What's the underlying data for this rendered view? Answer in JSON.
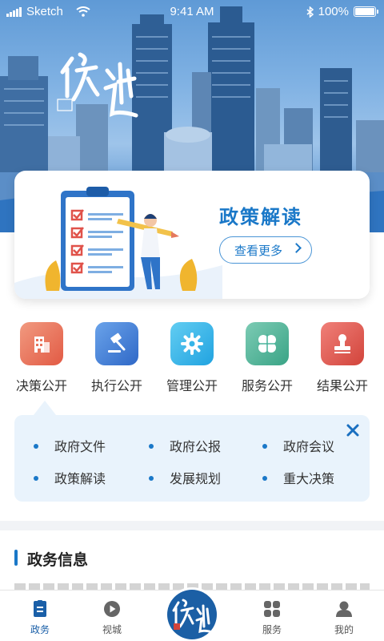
{
  "status_bar": {
    "carrier": "Sketch",
    "time": "9:41 AM",
    "battery": "100%"
  },
  "hero": {
    "logo_text": "行 远"
  },
  "banner": {
    "title": "政策解读",
    "button_label": "查看更多"
  },
  "categories": [
    {
      "label": "决策公开",
      "icon": "building-icon",
      "color": "#e9735b"
    },
    {
      "label": "执行公开",
      "icon": "gavel-icon",
      "color": "#3f7fd6"
    },
    {
      "label": "管理公开",
      "icon": "gear-icon",
      "color": "#35b5e8"
    },
    {
      "label": "服务公开",
      "icon": "clover-icon",
      "color": "#48b49b"
    },
    {
      "label": "结果公开",
      "icon": "seal-icon",
      "color": "#e05a4f"
    }
  ],
  "submenu": {
    "items": [
      "政府文件",
      "政府公报",
      "政府会议",
      "政策解读",
      "发展规划",
      "重大决策"
    ]
  },
  "section": {
    "title": "政务信息"
  },
  "tabbar": {
    "tabs": [
      {
        "label": "政务",
        "icon": "document-icon",
        "active": true
      },
      {
        "label": "视城",
        "icon": "play-icon",
        "active": false
      },
      {
        "label": "服务",
        "icon": "grid-icon",
        "active": false
      },
      {
        "label": "我的",
        "icon": "user-icon",
        "active": false
      }
    ]
  },
  "colors": {
    "accent": "#1a78c8",
    "submenu_bg": "#e9f3fc",
    "tab_active": "#1a5fa8"
  }
}
